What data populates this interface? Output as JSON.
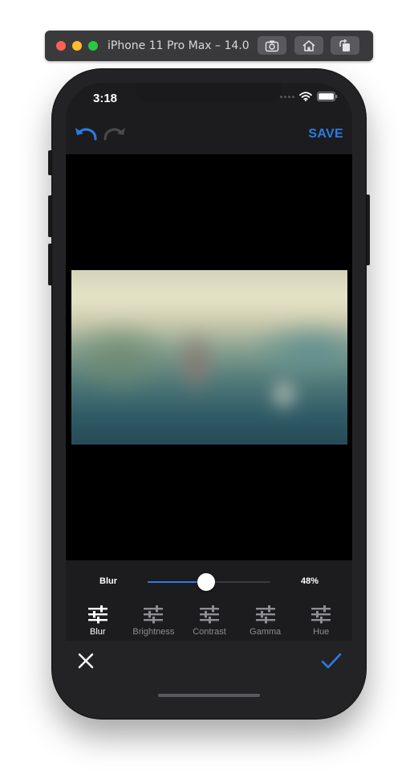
{
  "simulator": {
    "title": "iPhone 11 Pro Max – 14.0",
    "buttons": [
      "screenshot-icon",
      "home-icon",
      "rotate-icon"
    ]
  },
  "status_bar": {
    "time": "3:18",
    "icons": [
      "cellular-dots-icon",
      "wifi-icon",
      "battery-icon"
    ]
  },
  "nav": {
    "undo_icon": "undo-icon",
    "redo_icon": "redo-icon",
    "save_label": "SAVE"
  },
  "adjustment": {
    "label": "Blur",
    "value": 48,
    "value_text": "48%"
  },
  "tools": [
    {
      "label": "Blur",
      "icon": "sliders-icon",
      "active": true
    },
    {
      "label": "Brightness",
      "icon": "sliders-icon",
      "active": false
    },
    {
      "label": "Contrast",
      "icon": "sliders-icon",
      "active": false
    },
    {
      "label": "Gamma",
      "icon": "sliders-icon",
      "active": false
    },
    {
      "label": "Hue",
      "icon": "sliders-icon",
      "active": false
    }
  ],
  "bottom": {
    "cancel_icon": "close-icon",
    "confirm_icon": "checkmark-icon"
  },
  "colors": {
    "accent": "#2c7be5",
    "background": "#1c1c1e",
    "canvas": "#000000",
    "inactive": "#8e8e93"
  }
}
